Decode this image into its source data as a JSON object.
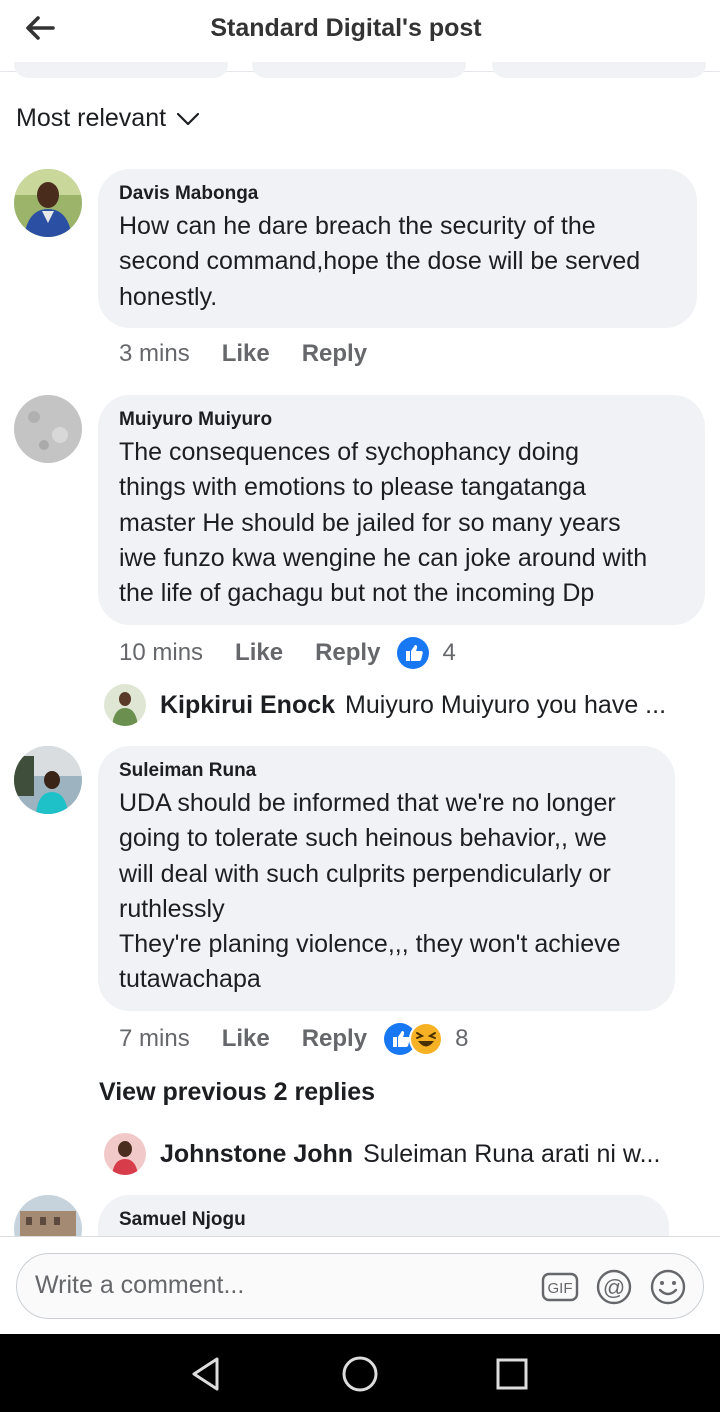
{
  "header": {
    "title": "Standard Digital's post"
  },
  "sort": {
    "label": "Most relevant"
  },
  "comments": [
    {
      "author": "Davis Mabonga",
      "text": "How can he dare breach the security of the\nsecond command,hope the dose will be served\nhonestly.",
      "time": "3 mins",
      "like": "Like",
      "reply": "Reply"
    },
    {
      "author": "Muiyuro Muiyuro",
      "text": "The consequences of sychophancy doing\nthings with emotions to please tangatanga\nmaster He should be jailed for so many years\niwe funzo kwa wengine he can joke around with\nthe life of gachagu but not the incoming Dp",
      "time": "10 mins",
      "like": "Like",
      "reply": "Reply",
      "reaction_count": "4",
      "reactions": [
        "like"
      ]
    },
    {
      "author": "Suleiman Runa",
      "text": "UDA should be informed that we're no longer\ngoing to tolerate such heinous behavior,, we\nwill deal with such culprits perpendicularly or\nruthlessly\nThey're planing violence,,, they won't achieve\ntutawachapa",
      "time": "7 mins",
      "like": "Like",
      "reply": "Reply",
      "reaction_count": "8",
      "reactions": [
        "like",
        "haha"
      ]
    },
    {
      "author": "Samuel Njogu"
    }
  ],
  "replies": [
    {
      "name": "Kipkirui Enock",
      "text": "Muiyuro Muiyuro you have ..."
    },
    {
      "name": "Johnstone John",
      "text": "Suleiman Runa arati ni w..."
    }
  ],
  "view_previous": "View previous 2 replies",
  "composer": {
    "placeholder": "Write a comment...",
    "icons": [
      "gif-icon",
      "mention-icon",
      "emoji-icon"
    ],
    "gif_label": "GIF",
    "mention_label": "@"
  },
  "navbar": {
    "icons": [
      "back-triangle-icon",
      "home-circle-icon",
      "recents-square-icon"
    ]
  },
  "colors": {
    "like_blue": "#1877f2",
    "haha_yellow": "#f7b125",
    "bubble": "#f0f2f5",
    "meta": "#65676b"
  }
}
